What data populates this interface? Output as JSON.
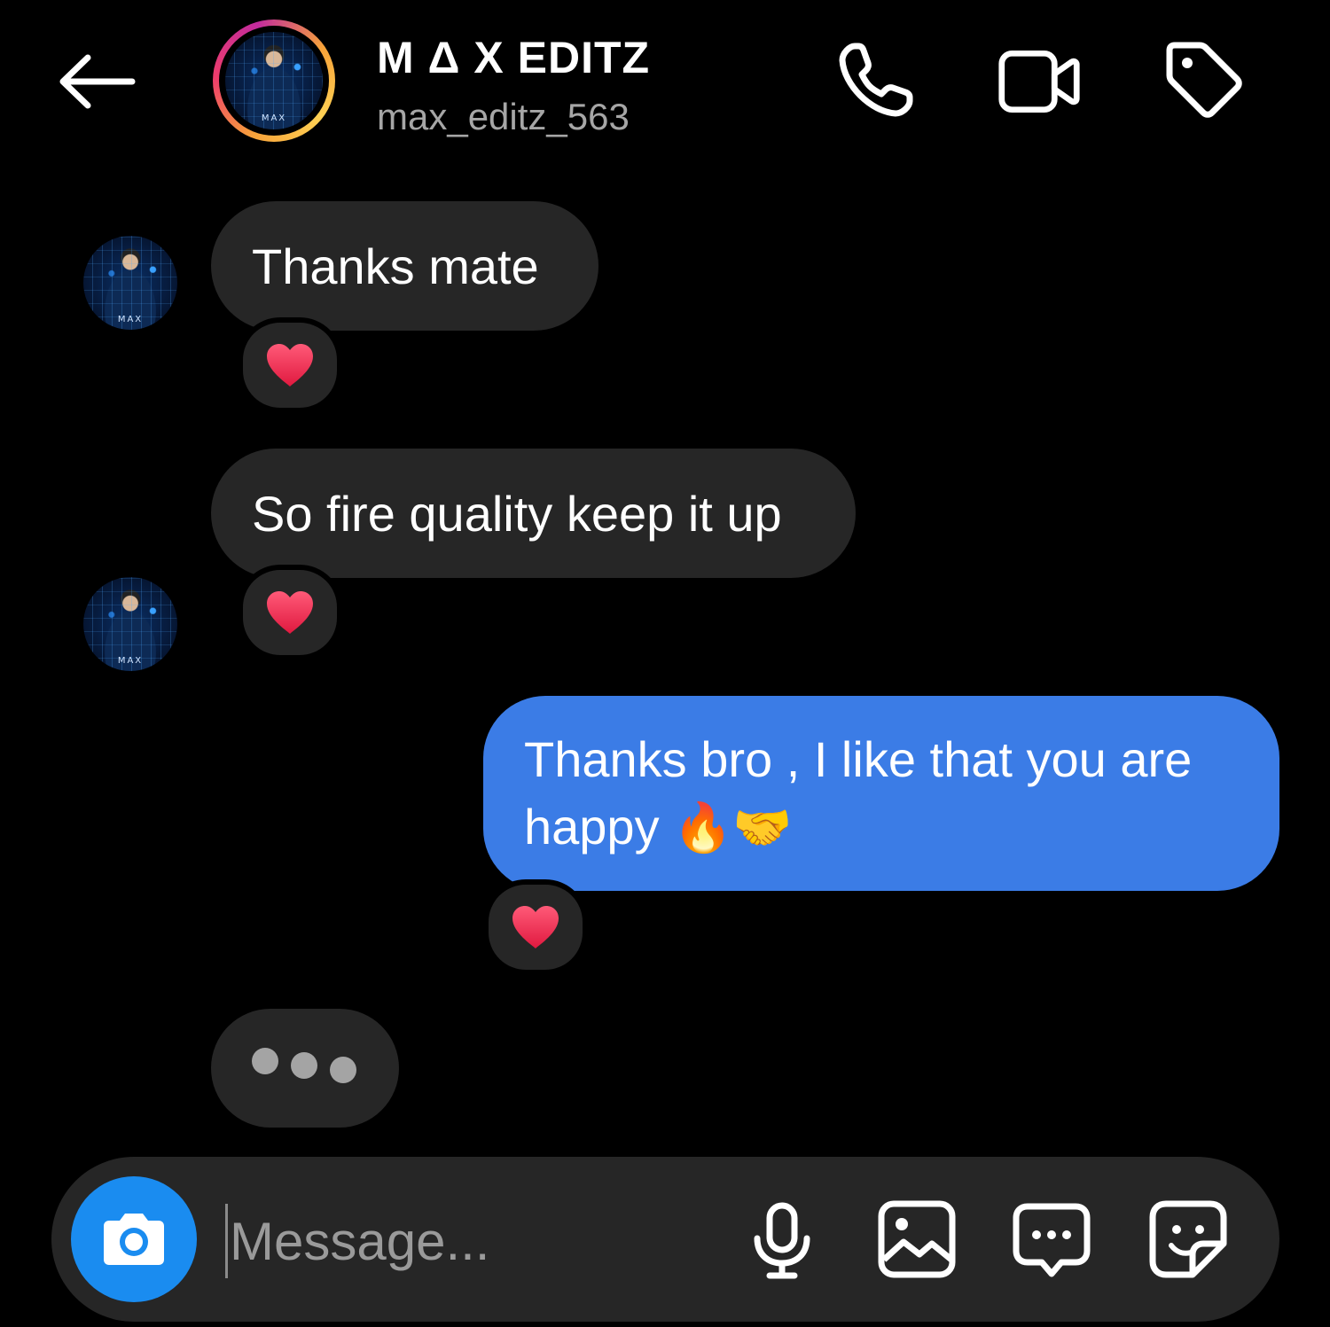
{
  "header": {
    "display_name": "M Δ X EDITZ",
    "username": "max_editz_563",
    "back_icon": "arrow-left-icon",
    "call_icon": "phone-icon",
    "video_icon": "video-camera-icon",
    "tag_icon": "tag-icon",
    "story_ring_colors": [
      "#f7a33a",
      "#ee3d6b",
      "#c22b9d"
    ]
  },
  "avatar": {
    "watermark": "MAX"
  },
  "messages": [
    {
      "direction": "incoming",
      "text": "Thanks mate",
      "reaction": "❤"
    },
    {
      "direction": "incoming",
      "text": "So fire quality keep it up",
      "reaction": "❤"
    },
    {
      "direction": "outgoing",
      "text_line1": "Thanks bro , I like that you are",
      "text_line2": "happy",
      "emojis": "🔥🤝",
      "reaction": "❤"
    },
    {
      "direction": "incoming",
      "typing": true
    }
  ],
  "composer": {
    "placeholder": "Message...",
    "camera_icon": "camera-icon",
    "mic_icon": "microphone-icon",
    "gallery_icon": "image-icon",
    "chat_icon": "chat-bubble-icon",
    "sticker_icon": "sticker-icon"
  },
  "colors": {
    "background": "#000000",
    "incoming_bubble": "#262626",
    "outgoing_bubble": "#3b7ce6",
    "camera_button": "#1a8cf0",
    "reaction_heart": "#f0325a"
  }
}
